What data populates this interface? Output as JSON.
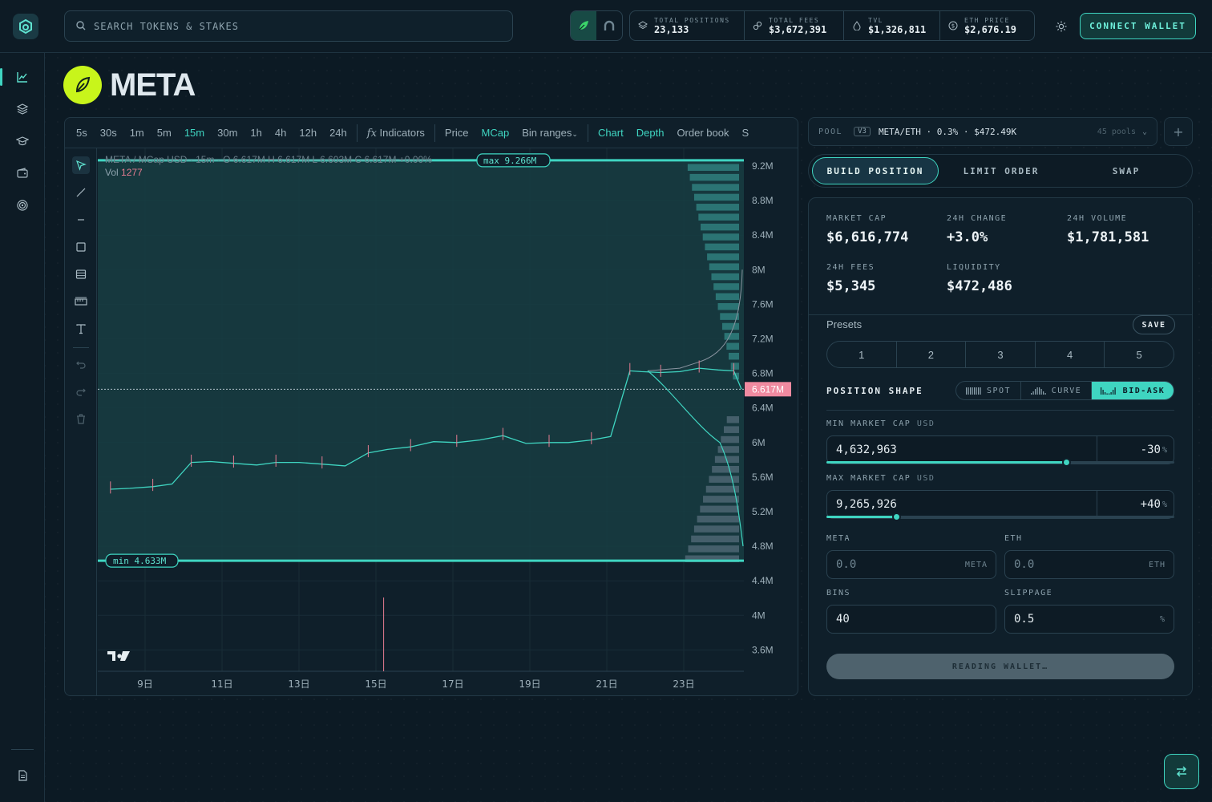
{
  "search": {
    "placeholder": "SEARCH TOKENS & STAKES"
  },
  "stats": [
    {
      "label": "TOTAL POSITIONS",
      "value": "23,133",
      "icon": "layers-icon"
    },
    {
      "label": "TOTAL FEES",
      "value": "$3,672,391",
      "icon": "link-icon"
    },
    {
      "label": "TVL",
      "value": "$1,326,811",
      "icon": "drop-icon"
    },
    {
      "label": "ETH PRICE",
      "value": "$2,676.19",
      "icon": "dollar-icon"
    }
  ],
  "connect_label": "CONNECT WALLET",
  "token": {
    "name": "META"
  },
  "toolbar": {
    "intervals": [
      "5s",
      "30s",
      "1m",
      "5m",
      "15m",
      "30m",
      "1h",
      "4h",
      "12h",
      "24h"
    ],
    "active_interval": "15m",
    "indicators": "Indicators",
    "price": "Price",
    "mcap": "MCap",
    "bin_ranges": "Bin ranges",
    "chart": "Chart",
    "depth": "Depth",
    "order_book": "Order book",
    "cut": "S"
  },
  "legend": {
    "symbol": "META / MCap USD · 15m · O 6.617M H 6.617M L 6.603M C 6.617M +0.00%",
    "vol_label": "Vol",
    "vol_value": "1277"
  },
  "chart_data": {
    "type": "line",
    "series_label": "META / MCap USD",
    "interval": "15m",
    "y_ticks": [
      "9.2M",
      "8.8M",
      "8.4M",
      "8M",
      "7.6M",
      "7.2M",
      "6.8M",
      "6.4M",
      "6M",
      "5.6M",
      "5.2M",
      "4.8M",
      "4.4M",
      "4M",
      "3.6M"
    ],
    "y_tick_values": [
      9.2,
      8.8,
      8.4,
      8.0,
      7.6,
      7.2,
      6.8,
      6.4,
      6.0,
      5.6,
      5.2,
      4.8,
      4.4,
      4.0,
      3.6
    ],
    "x_ticks": [
      "9日",
      "11日",
      "13日",
      "15日",
      "17日",
      "19日",
      "21日",
      "23日"
    ],
    "x_tick_values": [
      9,
      11,
      13,
      15,
      17,
      19,
      21,
      23
    ],
    "x": [
      8.1,
      8.6,
      9.2,
      9.7,
      10.2,
      10.7,
      11.3,
      11.9,
      12.4,
      13.0,
      13.6,
      14.2,
      14.8,
      15.3,
      15.9,
      16.5,
      17.1,
      17.7,
      18.3,
      18.9,
      19.5,
      20.0,
      20.6,
      21.1,
      21.6,
      21.9,
      22.4,
      22.9,
      23.4,
      23.9,
      24.3,
      24.5
    ],
    "values": [
      5.46,
      5.47,
      5.49,
      5.52,
      5.77,
      5.78,
      5.76,
      5.74,
      5.77,
      5.77,
      5.75,
      5.73,
      5.88,
      5.92,
      5.95,
      6.01,
      6.0,
      6.03,
      6.08,
      5.99,
      6.0,
      6.0,
      6.03,
      6.07,
      6.83,
      6.82,
      6.81,
      6.82,
      6.86,
      6.84,
      6.83,
      6.617
    ],
    "current_value": "6.617M",
    "max_label": "max",
    "max_value": "9.266M",
    "max_level": 9.266,
    "min_label": "min",
    "min_value": "4.633M",
    "min_level": 4.633,
    "volume_spike_day": 15.2,
    "colors": {
      "line": "#3fd5c1",
      "down": "#e67c91",
      "range_fill": "#1b4b4f",
      "current": "#f08aa0"
    }
  },
  "pool": {
    "label": "POOL",
    "version": "V3",
    "pair": "META/ETH · 0.3% · $472.49K",
    "count": "45 pools"
  },
  "tabs": [
    "BUILD POSITION",
    "LIMIT ORDER",
    "SWAP"
  ],
  "metrics": [
    {
      "label": "MARKET CAP",
      "value": "$6,616,774"
    },
    {
      "label": "24H CHANGE",
      "value": "+3.0%"
    },
    {
      "label": "24H VOLUME",
      "value": "$1,781,581"
    },
    {
      "label": "24H FEES",
      "value": "$5,345"
    },
    {
      "label": "LIQUIDITY",
      "value": "$472,486"
    }
  ],
  "presets": {
    "label": "Presets",
    "save": "SAVE",
    "items": [
      "1",
      "2",
      "3",
      "4",
      "5"
    ]
  },
  "shape": {
    "label": "POSITION SHAPE",
    "options": [
      "SPOT",
      "CURVE",
      "BID-ASK"
    ],
    "selected": "BID-ASK"
  },
  "min_cap": {
    "label": "MIN MARKET CAP",
    "unit": "USD",
    "value": "4,632,963",
    "pct": "-30",
    "slider": 0.69
  },
  "max_cap": {
    "label": "MAX MARKET CAP",
    "unit": "USD",
    "value": "9,265,926",
    "pct": "+40",
    "slider": 0.2
  },
  "meta_field": {
    "label": "META",
    "placeholder": "0.0",
    "unit": "META"
  },
  "eth_field": {
    "label": "ETH",
    "placeholder": "0.0",
    "unit": "ETH"
  },
  "bins": {
    "label": "BINS",
    "value": "40"
  },
  "slippage": {
    "label": "SLIPPAGE",
    "value": "0.5",
    "unit": "%"
  },
  "submit": "READING WALLET…",
  "pct_sign": "%"
}
